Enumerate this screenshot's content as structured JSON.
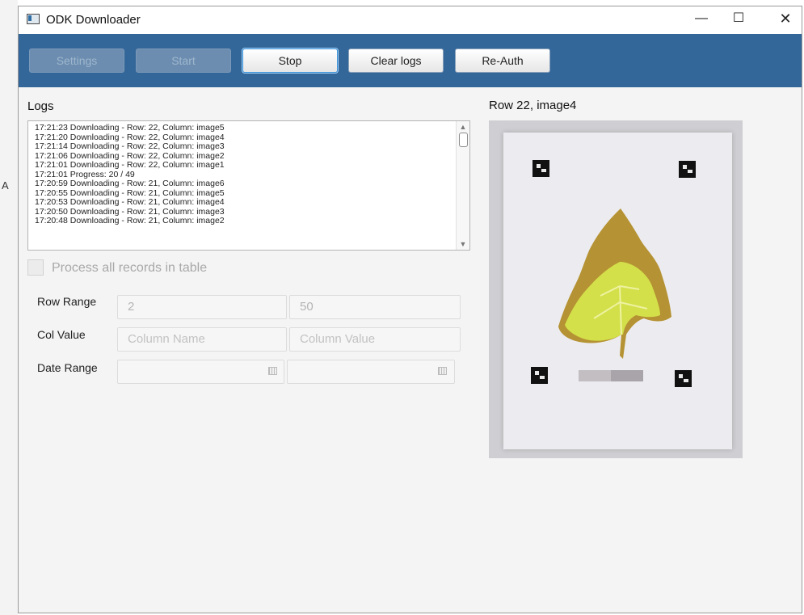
{
  "desktop": {
    "edge_mark": "A"
  },
  "window": {
    "title": "ODK Downloader",
    "controls": {
      "minimize": "—",
      "maximize": "☐",
      "close": "✕"
    }
  },
  "toolbar": {
    "buttons": [
      {
        "label": "Settings",
        "enabled": false
      },
      {
        "label": "Start",
        "enabled": false
      },
      {
        "label": "Stop",
        "enabled": true,
        "focused": true
      },
      {
        "label": "Clear logs",
        "enabled": true
      },
      {
        "label": "Re-Auth",
        "enabled": true
      }
    ]
  },
  "logs": {
    "label": "Logs",
    "lines": [
      "17:21:23 Downloading - Row: 22, Column: image5",
      "17:21:20 Downloading - Row: 22, Column: image4",
      "17:21:14 Downloading - Row: 22, Column: image3",
      "17:21:06 Downloading - Row: 22, Column: image2",
      "17:21:01 Downloading - Row: 22, Column: image1",
      "17:21:01 Progress: 20 / 49",
      "17:20:59 Downloading - Row: 21, Column: image6",
      "17:20:55 Downloading - Row: 21, Column: image5",
      "17:20:53 Downloading - Row: 21, Column: image4",
      "17:20:50 Downloading - Row: 21, Column: image3",
      "17:20:48 Downloading - Row: 21, Column: image2"
    ]
  },
  "options": {
    "process_all_label": "Process all records in table",
    "process_all_checked": false
  },
  "form": {
    "row_range": {
      "label": "Row Range",
      "from": "2",
      "to": "50"
    },
    "col_value": {
      "label": "Col Value",
      "name_placeholder": "Column Name",
      "value_placeholder": "Column Value"
    },
    "date_range": {
      "label": "Date Range",
      "from": "",
      "to": ""
    }
  },
  "preview": {
    "title": "Row 22, image4"
  },
  "colors": {
    "toolbar_bg": "#336699",
    "leaf_yellow": "#d7e24a",
    "leaf_brown": "#b08a2e"
  }
}
